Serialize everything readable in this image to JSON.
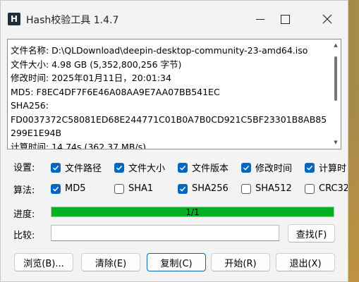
{
  "window": {
    "title": "Hash校验工具 1.4.7",
    "icon_letter": "H"
  },
  "output": {
    "lines": [
      "文件名称: D:\\QLDownload\\deepin-desktop-community-23-amd64.iso",
      "文件大小: 4.98 GB (5,352,800,256 字节)",
      "修改时间: 2025年01月11日，20:01:34",
      "MD5: F8EC4DF7F6E46A08AA9E7AA07BB541EC",
      "SHA256:",
      "FD0037372C58081ED68E244771C01B0A7B0CD921C5BF23301B8AB85299E1E94B",
      "计算时间: 14.74s (362.37 MB/s)"
    ]
  },
  "settings": {
    "label": "设置:",
    "options": [
      {
        "label": "文件路径",
        "checked": true
      },
      {
        "label": "文件大小",
        "checked": true
      },
      {
        "label": "文件版本",
        "checked": true
      },
      {
        "label": "修改时间",
        "checked": true
      },
      {
        "label": "计算时",
        "checked": true
      }
    ]
  },
  "algorithms": {
    "label": "算法:",
    "options": [
      {
        "label": "MD5",
        "checked": true
      },
      {
        "label": "SHA1",
        "checked": false
      },
      {
        "label": "SHA256",
        "checked": true
      },
      {
        "label": "SHA512",
        "checked": false
      },
      {
        "label": "CRC32",
        "checked": false
      }
    ]
  },
  "progress": {
    "label": "进度:",
    "text": "1/1",
    "fraction": 1.0
  },
  "compare": {
    "label": "比较:",
    "value": "",
    "find_button": "查找(F)"
  },
  "buttons": {
    "browse": "浏览(B)...",
    "clear": "清除(E)",
    "copy": "复制(C)",
    "start": "开始(R)",
    "exit": "退出(X)"
  },
  "colors": {
    "accent": "#0067c0",
    "progress": "#06b025"
  }
}
